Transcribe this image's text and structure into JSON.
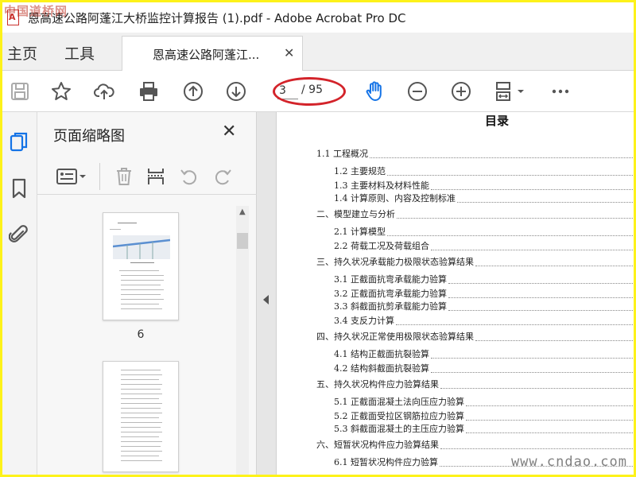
{
  "window": {
    "title": "恩高速公路阿蓬江大桥监控计算报告 (1).pdf - Adobe Acrobat Pro DC",
    "watermark_top": "中国道桥网",
    "watermark_bottom": "www.cndao.com"
  },
  "nav": {
    "home": "主页",
    "tools": "工具",
    "doc_tab": "恩高速公路阿蓬江...",
    "doc_tab_close": "✕"
  },
  "toolbar": {
    "icons": [
      "save-icon",
      "star-icon",
      "cloud-upload-icon",
      "print-icon",
      "arrow-up-icon",
      "arrow-down-icon",
      "hand-icon",
      "zoom-out-icon",
      "zoom-in-icon",
      "fit-page-icon",
      "more-icon"
    ],
    "page_current": "3",
    "page_total": "/ 95",
    "highlight_color": "#d3232a",
    "accent_color": "#1473e6"
  },
  "panel": {
    "title": "页面缩略图",
    "close": "✕",
    "thumbnails": [
      {
        "label": "6"
      },
      {
        "label": ""
      }
    ]
  },
  "toc": {
    "title": "目录",
    "entries": [
      {
        "text": "1.1 工程概况",
        "level": 1
      },
      {
        "text": "1.2 主要规范",
        "level": 2
      },
      {
        "text": "1.3 主要材料及材料性能",
        "level": 2
      },
      {
        "text": "1.4 计算原则、内容及控制标准",
        "level": 2
      },
      {
        "text": "二、模型建立与分析",
        "level": 1
      },
      {
        "text": "2.1 计算模型",
        "level": 2
      },
      {
        "text": "2.2 荷载工况及荷载组合",
        "level": 2
      },
      {
        "text": "三、持久状况承载能力极限状态验算结果",
        "level": 1
      },
      {
        "text": "3.1 正截面抗弯承载能力验算",
        "level": 2
      },
      {
        "text": "3.2 正截面抗弯承载能力验算",
        "level": 2
      },
      {
        "text": "3.3 斜截面抗剪承载能力验算",
        "level": 2
      },
      {
        "text": "3.4 支反力计算",
        "level": 2
      },
      {
        "text": "四、持久状况正常使用极限状态验算结果",
        "level": 1
      },
      {
        "text": "4.1 结构正截面抗裂验算",
        "level": 2
      },
      {
        "text": "4.2 结构斜截面抗裂验算",
        "level": 2
      },
      {
        "text": "五、持久状况构件应力验算结果",
        "level": 1
      },
      {
        "text": "5.1 正截面混凝土法向压应力验算",
        "level": 2
      },
      {
        "text": "5.2 正截面受拉区钢筋拉应力验算",
        "level": 2
      },
      {
        "text": "5.3 斜截面混凝土的主压应力验算",
        "level": 2
      },
      {
        "text": "六、短暂状况构件应力验算结果",
        "level": 1
      },
      {
        "text": "6.1 短暂状况构件应力验算",
        "level": 2
      }
    ]
  }
}
